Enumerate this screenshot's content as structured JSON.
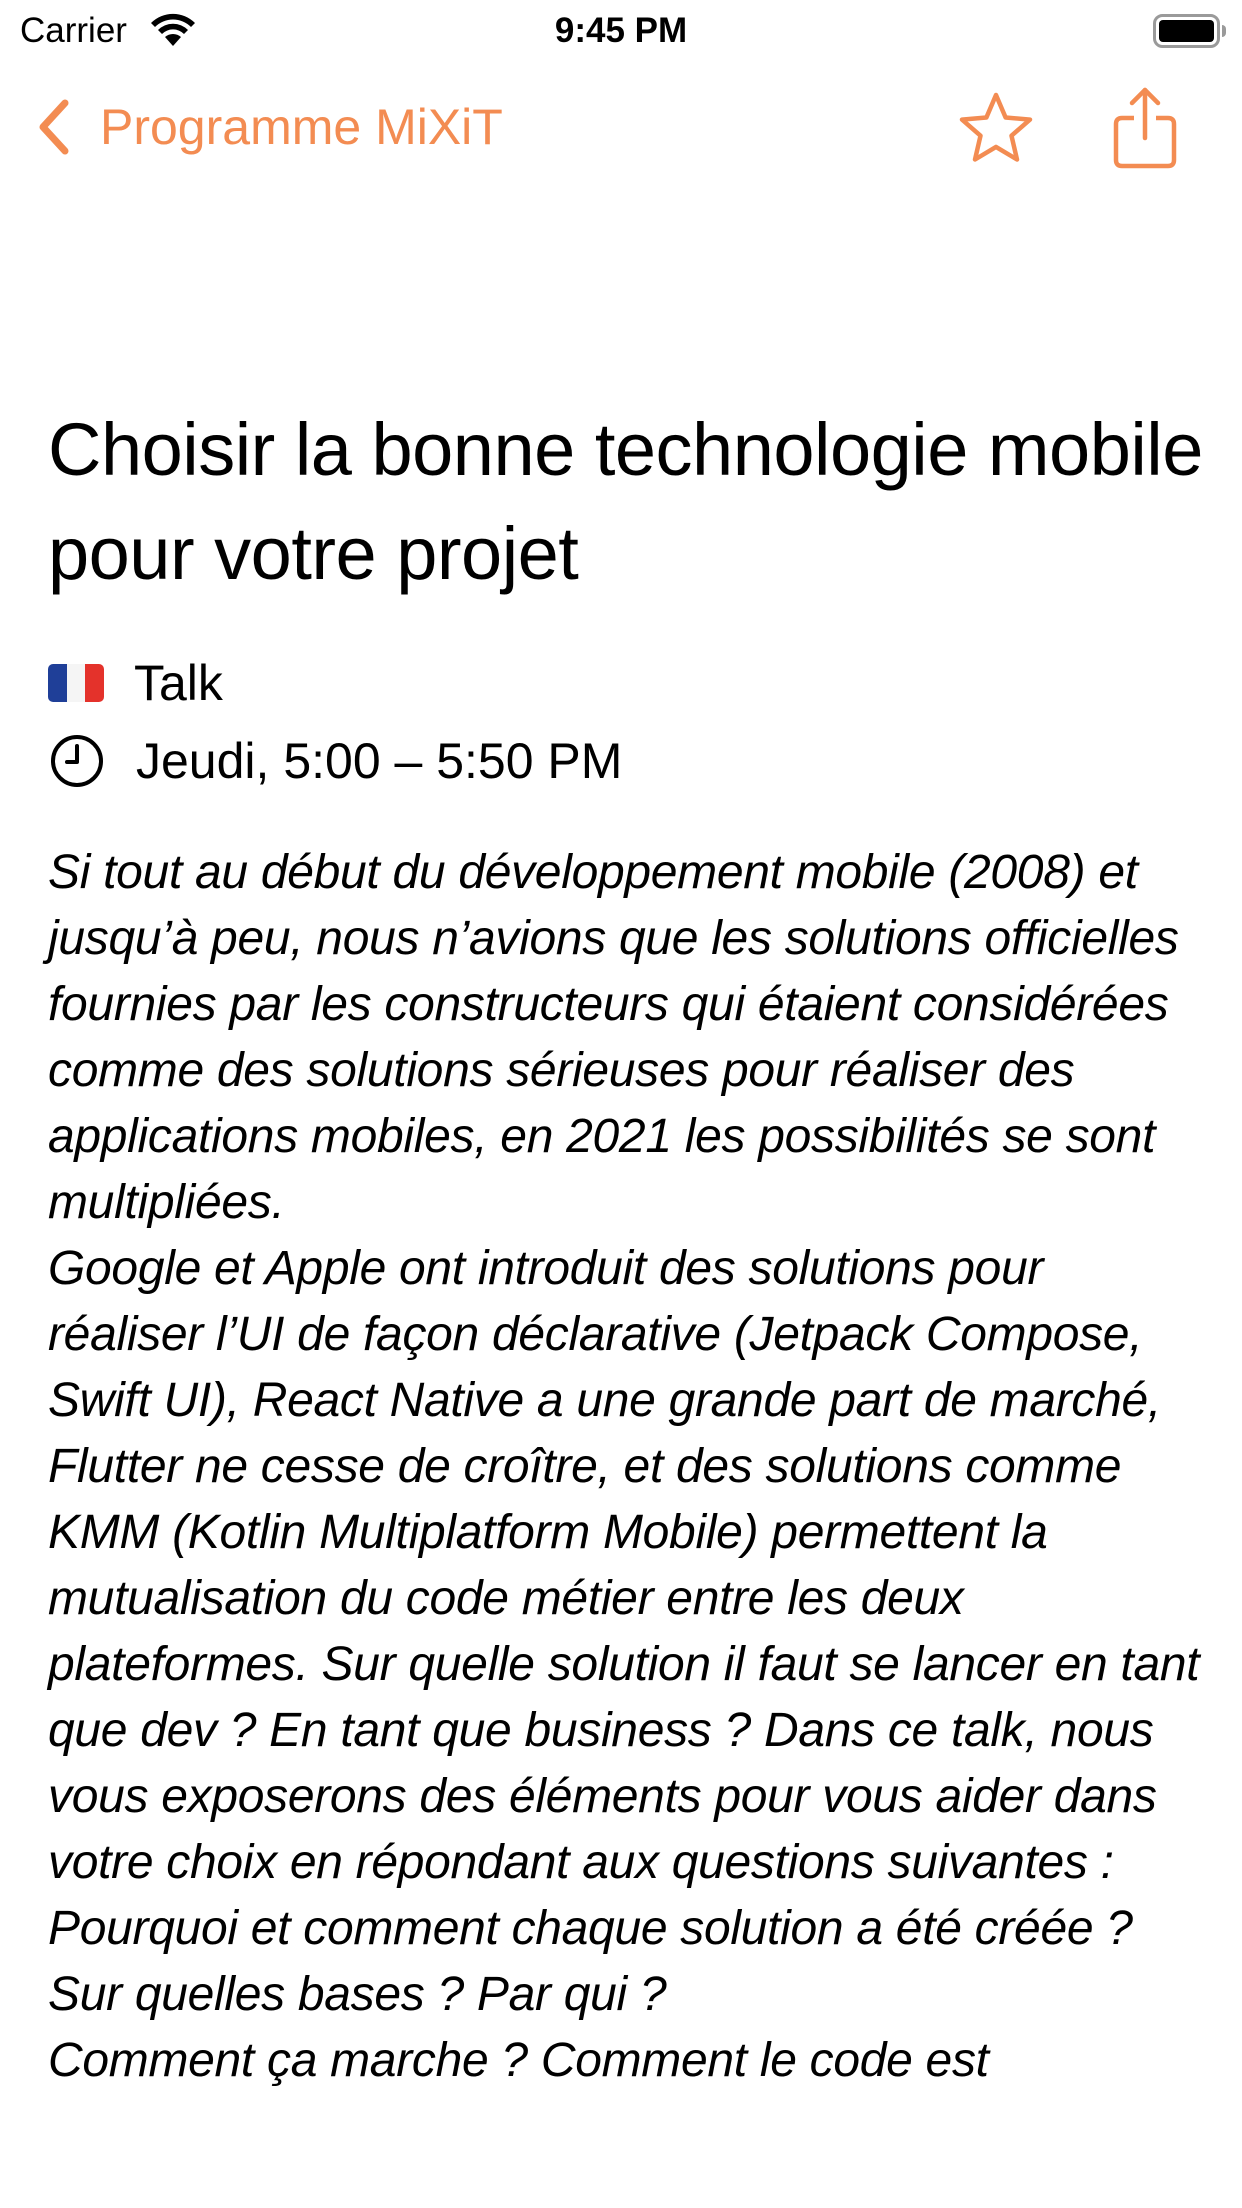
{
  "status_bar": {
    "carrier": "Carrier",
    "time": "9:45 PM",
    "wifi_icon": "wifi-icon",
    "battery_icon": "battery-icon"
  },
  "nav_bar": {
    "back_label": "Programme MiXiT",
    "back_icon": "chevron-left-icon",
    "favorite_icon": "star-outline-icon",
    "share_icon": "share-icon",
    "accent_color": "#f38c52"
  },
  "talk": {
    "title": "Choisir la bonne technologie mobile pour votre projet",
    "language_flag": "french-flag-icon",
    "format": "Talk",
    "schedule": "Jeudi, 5:00 – 5:50 PM",
    "description": "Si tout au début du développement mobile (2008) et jusqu’à peu, nous n’avions que les solutions officielles fournies par les constructeurs qui étaient considérées comme des solutions sérieuses pour réaliser des applications mobiles, en 2021 les possibilités se sont multipliées.\nGoogle et Apple ont introduit des solutions pour réaliser l’UI de façon déclarative (Jetpack Compose, Swift UI), React Native a une grande part de marché, Flutter ne cesse de croître, et des solutions comme KMM (Kotlin Multiplatform Mobile) permettent la mutualisation du code métier entre les deux plateformes. Sur quelle solution il faut se lancer en tant que dev ? En tant que business ? Dans ce talk, nous vous exposerons des éléments pour vous aider dans votre choix en répondant aux questions suivantes :\nPourquoi et comment chaque solution a été créée ? Sur quelles bases ? Par qui ?\nComment ça marche ? Comment le code est"
  }
}
